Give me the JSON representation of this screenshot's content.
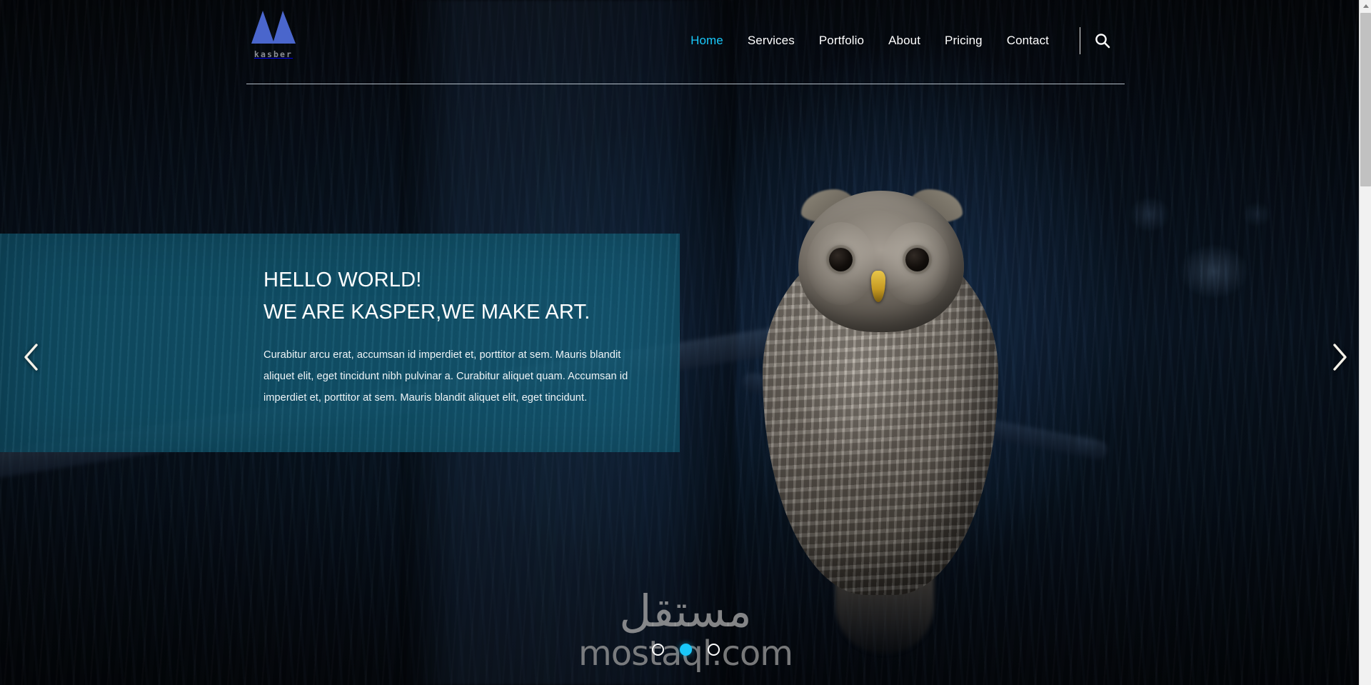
{
  "site": {
    "brand_name": "kasber",
    "logo_icon": "double-triangle-m-logo",
    "accent_color": "#19c8fa",
    "logo_color": "#4a66cc",
    "panel_color": "#105068"
  },
  "header": {
    "nav_items": [
      {
        "label": "Home",
        "active": true
      },
      {
        "label": "Services",
        "active": false
      },
      {
        "label": "Portfolio",
        "active": false
      },
      {
        "label": "About",
        "active": false
      },
      {
        "label": "Pricing",
        "active": false
      },
      {
        "label": "Contact",
        "active": false
      }
    ],
    "search_icon": "search-icon"
  },
  "hero": {
    "heading_line1": "HELLO WORLD!",
    "heading_line2": "WE ARE KASPER,WE MAKE ART.",
    "paragraph": "Curabitur arcu erat, accumsan id imperdiet et, porttitor at sem. Mauris blandit aliquet elit, eget tincidunt nibh pulvinar a. Curabitur aliquet quam. Accumsan id imperdiet et, porttitor at sem. Mauris blandit aliquet elit, eget tincidunt.",
    "prev_icon": "chevron-left-icon",
    "next_icon": "chevron-right-icon",
    "bullets": [
      {
        "index": 1,
        "active": false
      },
      {
        "index": 2,
        "active": true
      },
      {
        "index": 3,
        "active": false
      }
    ]
  },
  "watermark": {
    "arabic": "مستقل",
    "latin": "mostaql.com"
  }
}
